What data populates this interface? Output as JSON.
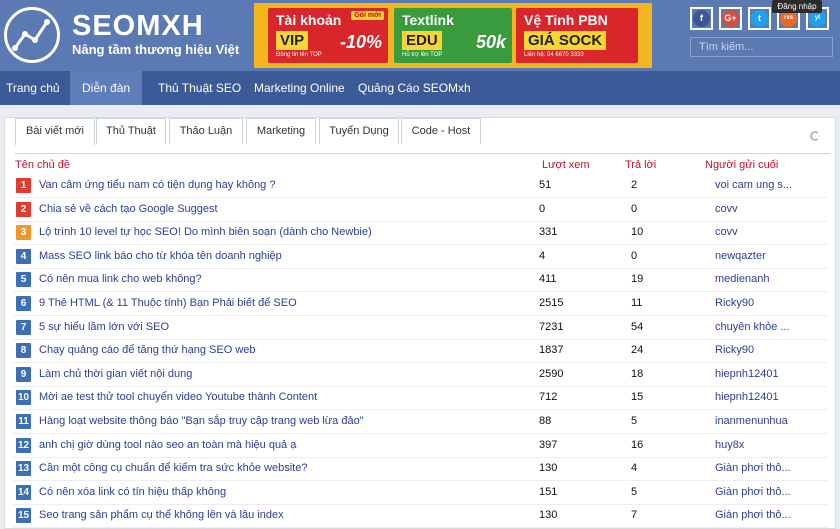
{
  "header": {
    "brand": "SEOMXH",
    "tagline": "Nâng tầm thương hiệu Việt",
    "ads": [
      {
        "line1": "Tài khoản",
        "tag": "Gói mới",
        "line2": "VIP",
        "line3": "Đồng tin lên TOP",
        "big": "-10%"
      },
      {
        "line1": "Textlink",
        "tag": "",
        "line2": "EDU",
        "line3": "Hỗ trợ lên TOP",
        "big": "50k"
      },
      {
        "line1": "Vệ Tinh PBN",
        "tag": "",
        "line2": "GIÁ SOCK",
        "line3": "Liên hệ: 04 6670 3333",
        "big": ""
      }
    ],
    "social": [
      "f",
      "G+",
      "t",
      "rss",
      "yt"
    ],
    "tooltip": "Đăng nhập",
    "search_placeholder": "Tìm kiếm..."
  },
  "nav": {
    "items": [
      "Trang chủ",
      "Diễn đàn",
      "Thủ Thuật SEO",
      "Marketing Online",
      "Quảng Cáo SEOMxh"
    ]
  },
  "tabs": [
    "Bài viết mới",
    "Thủ Thuật",
    "Thảo Luận",
    "Marketing",
    "Tuyển Dụng",
    "Code - Host"
  ],
  "columns": {
    "topic": "Tên chủ đề",
    "views": "Lượt xem",
    "replies": "Trả lời",
    "last": "Người gửi cuối"
  },
  "colors": {
    "red": "#e03c31",
    "orange": "#f0962a",
    "blue": "#3c6fb6",
    "accent": "#c8102e"
  },
  "rows": [
    {
      "n": "1",
      "title": "Van câm ứng tiểu nam có tiện dụng hay không ?",
      "views": "51",
      "replies": "2",
      "author": "voi cam ung s..."
    },
    {
      "n": "2",
      "title": "Chia sẻ về cách tạo Google Suggest",
      "views": "0",
      "replies": "0",
      "author": "covv"
    },
    {
      "n": "3",
      "title": "Lộ trình 10 level tự học SEO! Do mình biên soạn (dành cho Newbie)",
      "views": "331",
      "replies": "10",
      "author": "covv"
    },
    {
      "n": "4",
      "title": "Mass SEO link báo cho từ khóa tên doanh nghiệp",
      "views": "4",
      "replies": "0",
      "author": "newqazter"
    },
    {
      "n": "5",
      "title": "Có nên mua link cho web không?",
      "views": "411",
      "replies": "19",
      "author": "medienanh"
    },
    {
      "n": "6",
      "title": "9 Thẻ HTML (& 11 Thuộc tính) Bạn Phải biết để SEO",
      "views": "2515",
      "replies": "11",
      "author": "Ricky90"
    },
    {
      "n": "7",
      "title": "5 sự hiểu lầm lớn với SEO",
      "views": "7231",
      "replies": "54",
      "author": "chuyên khỏe ..."
    },
    {
      "n": "8",
      "title": "Chạy quảng cáo để tăng thứ hạng SEO web",
      "views": "1837",
      "replies": "24",
      "author": "Ricky90"
    },
    {
      "n": "9",
      "title": "Làm chủ thời gian viết nội dung",
      "views": "2590",
      "replies": "18",
      "author": "hiepnh12401"
    },
    {
      "n": "10",
      "title": "Mời ae test thử tool chuyển video Youtube thành Content",
      "views": "712",
      "replies": "15",
      "author": "hiepnh12401"
    },
    {
      "n": "11",
      "title": "Hàng loạt website thông báo \"Bạn sắp truy cập trang web lừa đảo\"",
      "views": "88",
      "replies": "5",
      "author": "inanmenunhua"
    },
    {
      "n": "12",
      "title": "anh chị giờ dùng tool nào seo an toàn mà hiệu quả ạ",
      "views": "397",
      "replies": "16",
      "author": "huy8x"
    },
    {
      "n": "13",
      "title": "Cần một công cụ chuẩn để kiểm tra sức khỏe website?",
      "views": "130",
      "replies": "4",
      "author": "Giàn phơi thô..."
    },
    {
      "n": "14",
      "title": "Có nên xóa link có tín hiệu thấp không",
      "views": "151",
      "replies": "5",
      "author": "Giàn phơi thô..."
    },
    {
      "n": "15",
      "title": "Seo trang sản phẩm cụ thể không lên và lâu index",
      "views": "130",
      "replies": "7",
      "author": "Giàn phơi thô..."
    }
  ]
}
